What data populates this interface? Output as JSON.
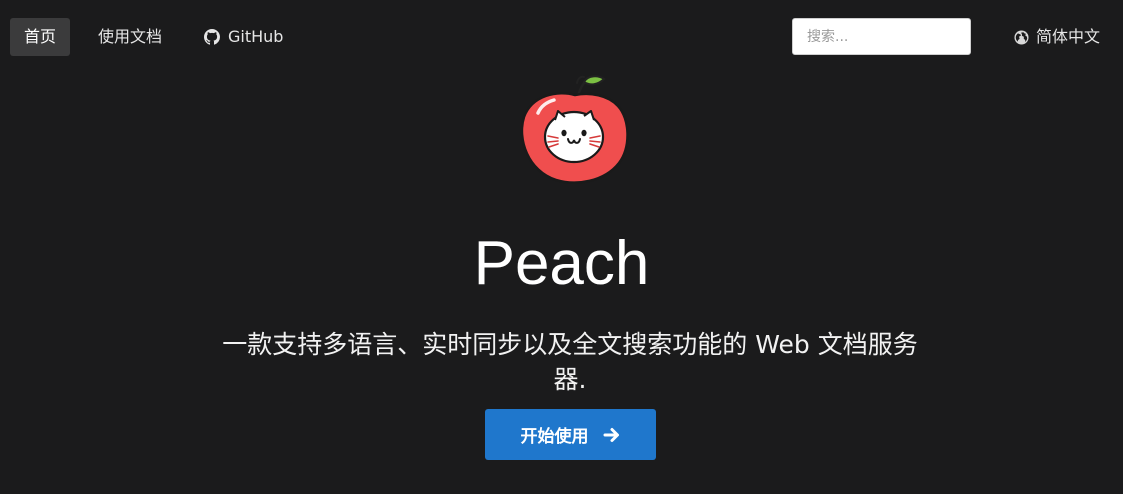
{
  "nav": {
    "home_label": "首页",
    "docs_label": "使用文档",
    "github_label": "GitHub",
    "github_icon": "github-icon"
  },
  "search": {
    "placeholder": "搜索...",
    "value": ""
  },
  "language": {
    "label": "简体中文",
    "icon": "globe-icon"
  },
  "hero": {
    "logo_icon": "peach-logo",
    "title": "Peach",
    "subtitle": "一款支持多语言、实时同步以及全文搜索功能的 Web 文档服务器.",
    "cta_label": "开始使用",
    "cta_icon": "arrow-right-icon"
  },
  "colors": {
    "background": "#1b1b1c",
    "active_nav": "#3b3b3c",
    "accent": "#1f77cc",
    "peach": "#f04e4e"
  }
}
